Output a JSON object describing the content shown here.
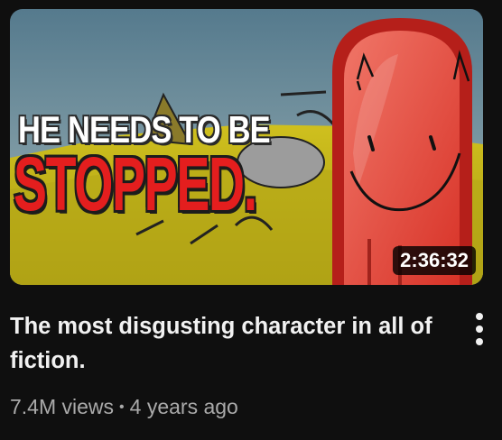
{
  "video": {
    "thumbnail": {
      "overlay_line1": "HE NEEDS TO BE",
      "overlay_line2": "STOPPED.",
      "duration": "2:36:32"
    },
    "title": "The most disgusting character in all of fiction.",
    "views": "7.4M views",
    "separator": "•",
    "age": "4 years ago",
    "menu_icon": "more-vert-icon"
  },
  "colors": {
    "background": "#0f0f0f",
    "title_text": "#f1f1f1",
    "meta_text": "#aaaaaa",
    "overlay_red": "#e41e1e"
  }
}
